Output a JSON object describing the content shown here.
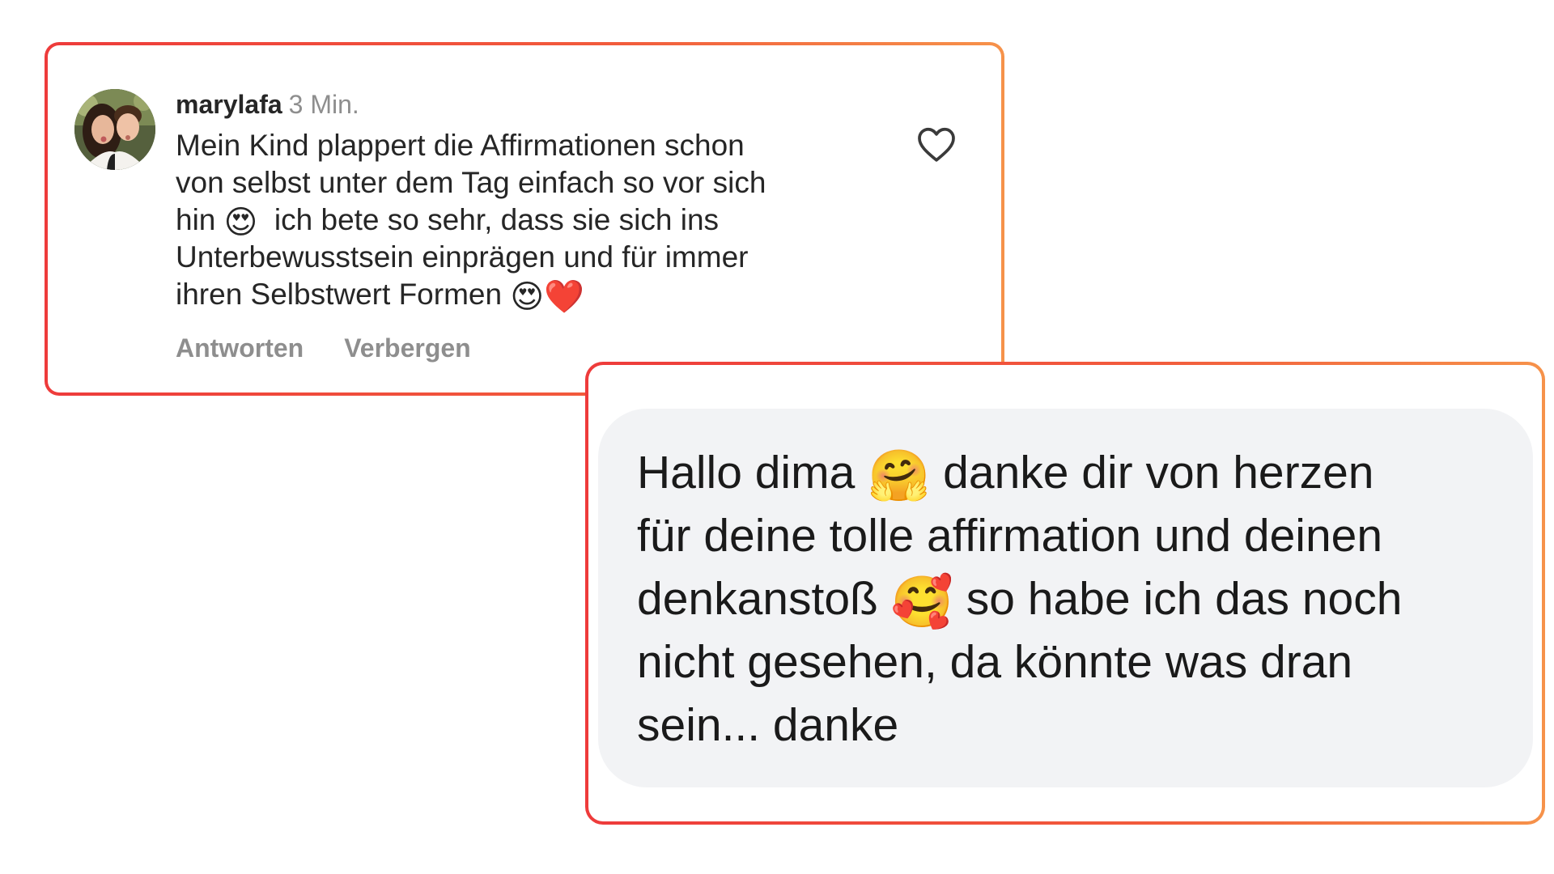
{
  "comment": {
    "username": "marylafa",
    "timestamp": "3 Min.",
    "lines": [
      {
        "text": "Mein Kind plappert die Affirmationen schon"
      },
      {
        "text": "von selbst unter dem Tag einfach so vor sich"
      },
      {
        "text_before": "hin ",
        "emoji": "😍",
        "text_after": "  ich bete so sehr, dass sie sich ins"
      },
      {
        "text": "Unterbewusstsein einprägen und für immer"
      },
      {
        "text_before": "ihren Selbstwert Formen ",
        "emoji": "😍",
        "emoji2": "❤️"
      }
    ],
    "actions": {
      "reply_label": "Antworten",
      "hide_label": "Verbergen"
    },
    "like_icon": "heart-outline-icon"
  },
  "reply": {
    "lines": [
      {
        "text_before": "Hallo dima ",
        "emoji": "🤗",
        "text_after": " danke dir von herzen"
      },
      {
        "text": "für deine tolle affirmation und deinen"
      },
      {
        "text_before": "denkanstoß ",
        "emoji": "🥰",
        "text_after": " so habe ich das noch"
      },
      {
        "text": "nicht gesehen, da könnte was dran"
      },
      {
        "text": "sein... danke"
      }
    ]
  },
  "colors": {
    "card_border_start": "#ee3b3b",
    "card_border_end": "#f6924a",
    "bubble_background": "#f2f3f5",
    "secondary_text": "#8e8e8e"
  }
}
